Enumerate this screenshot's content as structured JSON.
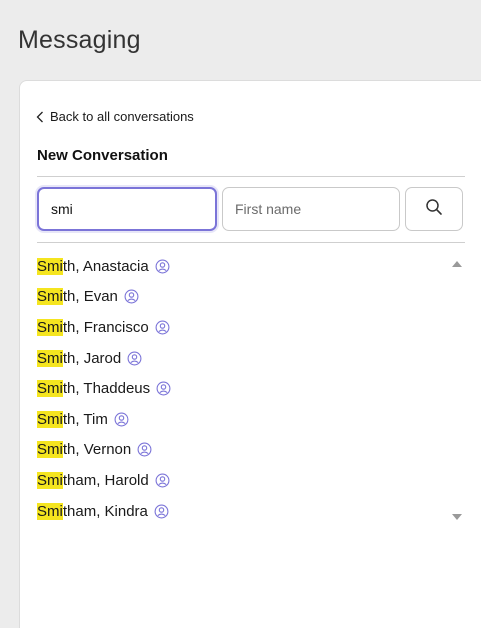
{
  "page": {
    "title": "Messaging"
  },
  "panel": {
    "back_label": "Back to all conversations",
    "section_title": "New Conversation"
  },
  "search": {
    "last_name_value": "smi",
    "first_name_placeholder": "First name",
    "button_icon": "search-icon"
  },
  "results": {
    "highlight_color": "#f5e51f",
    "items": [
      {
        "match": "Smi",
        "rest": "th, Anastacia"
      },
      {
        "match": "Smi",
        "rest": "th, Evan"
      },
      {
        "match": "Smi",
        "rest": "th, Francisco"
      },
      {
        "match": "Smi",
        "rest": "th, Jarod"
      },
      {
        "match": "Smi",
        "rest": "th, Thaddeus"
      },
      {
        "match": "Smi",
        "rest": "th, Tim"
      },
      {
        "match": "Smi",
        "rest": "th, Vernon"
      },
      {
        "match": "Smi",
        "rest": "tham, Harold"
      },
      {
        "match": "Smi",
        "rest": "tham, Kindra"
      }
    ]
  },
  "theme": {
    "accent": "#7b74d8"
  }
}
